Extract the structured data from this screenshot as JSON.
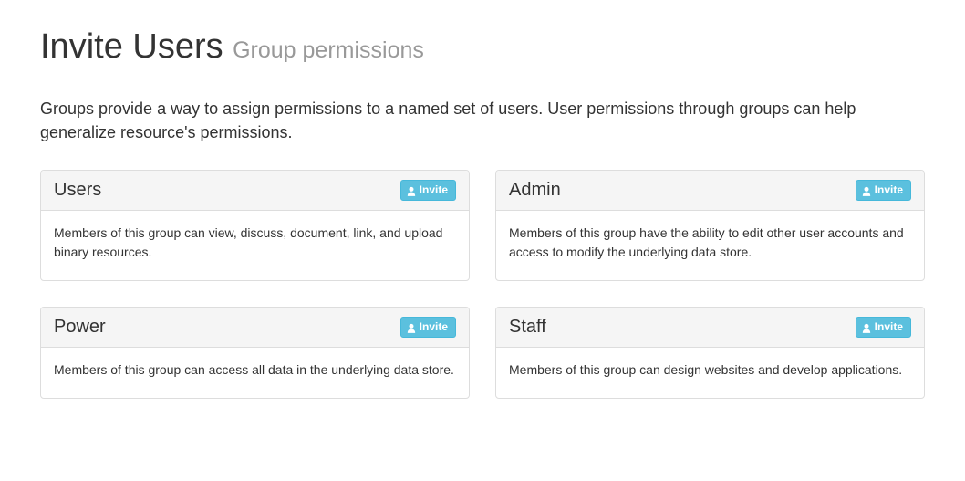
{
  "heading": {
    "title": "Invite Users",
    "subtitle": "Group permissions"
  },
  "description": "Groups provide a way to assign permissions to a named set of users. User permissions through groups can help generalize resource's permissions.",
  "invite_label": "Invite",
  "groups": [
    {
      "name": "Users",
      "description": "Members of this group can view, discuss, document, link, and upload binary resources."
    },
    {
      "name": "Admin",
      "description": "Members of this group have the ability to edit other user accounts and access to modify the underlying data store."
    },
    {
      "name": "Power",
      "description": "Members of this group can access all data in the underlying data store."
    },
    {
      "name": "Staff",
      "description": "Members of this group can design websites and develop applications."
    }
  ]
}
